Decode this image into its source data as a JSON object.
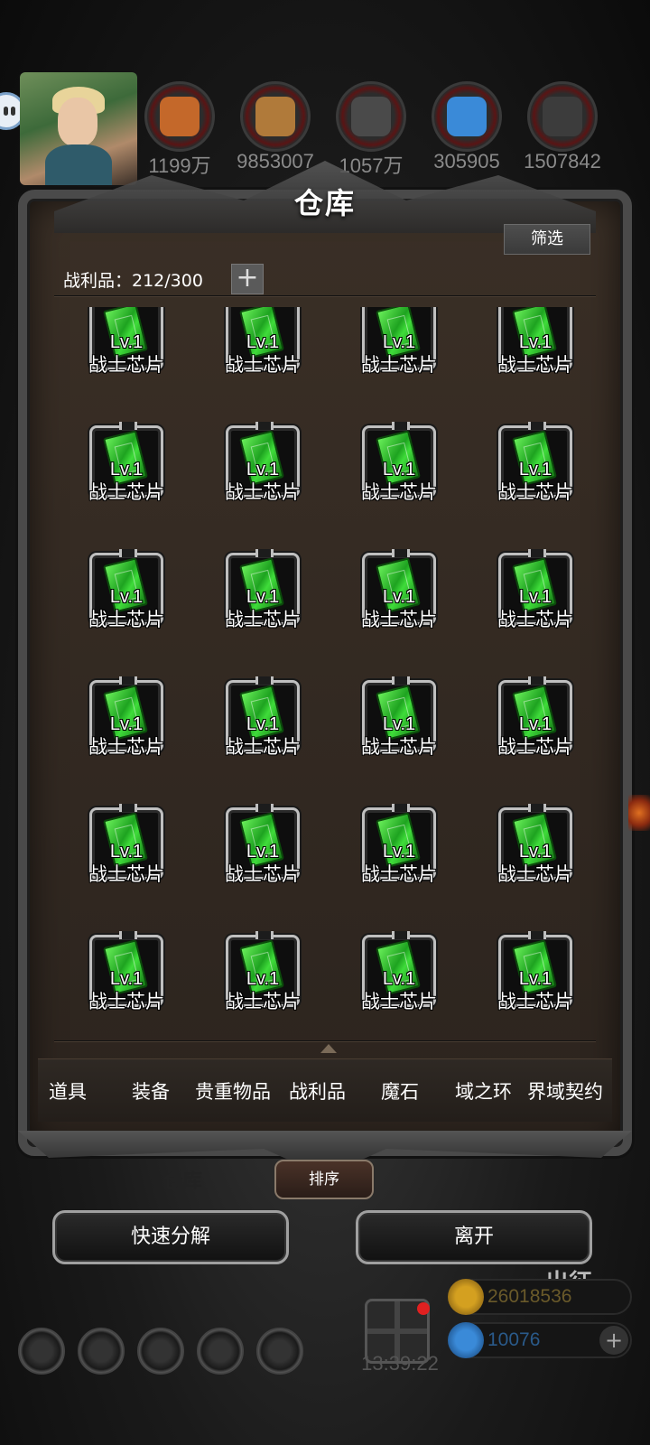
{
  "resources": [
    {
      "name": "food-resource-icon",
      "value": "1199万",
      "color": "#c4682a"
    },
    {
      "name": "wood-resource-icon",
      "value": "9853007",
      "color": "#b07a3a"
    },
    {
      "name": "stone-resource-icon",
      "value": "1057万",
      "color": "#4a4a4a"
    },
    {
      "name": "crystal-resource-icon",
      "value": "305905",
      "color": "#3a8ad8"
    },
    {
      "name": "iron-resource-icon",
      "value": "1507842",
      "color": "#3c3c3c"
    }
  ],
  "panel": {
    "title": "仓库",
    "filter_label": "筛选",
    "counter_label": "战利品：212/300",
    "add_label": "+"
  },
  "items": [
    {
      "level": "Lv.1",
      "name": "战士芯片"
    },
    {
      "level": "Lv.1",
      "name": "战士芯片"
    },
    {
      "level": "Lv.1",
      "name": "战士芯片"
    },
    {
      "level": "Lv.1",
      "name": "战士芯片"
    },
    {
      "level": "Lv.1",
      "name": "战士芯片"
    },
    {
      "level": "Lv.1",
      "name": "战士芯片"
    },
    {
      "level": "Lv.1",
      "name": "战士芯片"
    },
    {
      "level": "Lv.1",
      "name": "战士芯片"
    },
    {
      "level": "Lv.1",
      "name": "战士芯片"
    },
    {
      "level": "Lv.1",
      "name": "战士芯片"
    },
    {
      "level": "Lv.1",
      "name": "战士芯片"
    },
    {
      "level": "Lv.1",
      "name": "战士芯片"
    },
    {
      "level": "Lv.1",
      "name": "战士芯片"
    },
    {
      "level": "Lv.1",
      "name": "战士芯片"
    },
    {
      "level": "Lv.1",
      "name": "战士芯片"
    },
    {
      "level": "Lv.1",
      "name": "战士芯片"
    },
    {
      "level": "Lv.1",
      "name": "战士芯片"
    },
    {
      "level": "Lv.1",
      "name": "战士芯片"
    },
    {
      "level": "Lv.1",
      "name": "战士芯片"
    },
    {
      "level": "Lv.1",
      "name": "战士芯片"
    },
    {
      "level": "Lv.1",
      "name": "战士芯片"
    },
    {
      "level": "Lv.1",
      "name": "战士芯片"
    },
    {
      "level": "Lv.1",
      "name": "战士芯片"
    },
    {
      "level": "Lv.1",
      "name": "战士芯片"
    }
  ],
  "tabs": [
    "道具",
    "装备",
    "贵重物品",
    "战利品",
    "魔石",
    "域之环",
    "界域契约"
  ],
  "sort_label": "排序",
  "background": {
    "warehouse_label": "仓库",
    "expedition_label": "出征"
  },
  "actions": {
    "quick_decompose": "快速分解",
    "leave": "离开"
  },
  "footer": {
    "timer": "13:39:22",
    "gold_value": "26018536",
    "gem_value": "10076",
    "gem_plus": "+",
    "gold_color": "#d4a020",
    "gem_color": "#3a8ad8"
  }
}
